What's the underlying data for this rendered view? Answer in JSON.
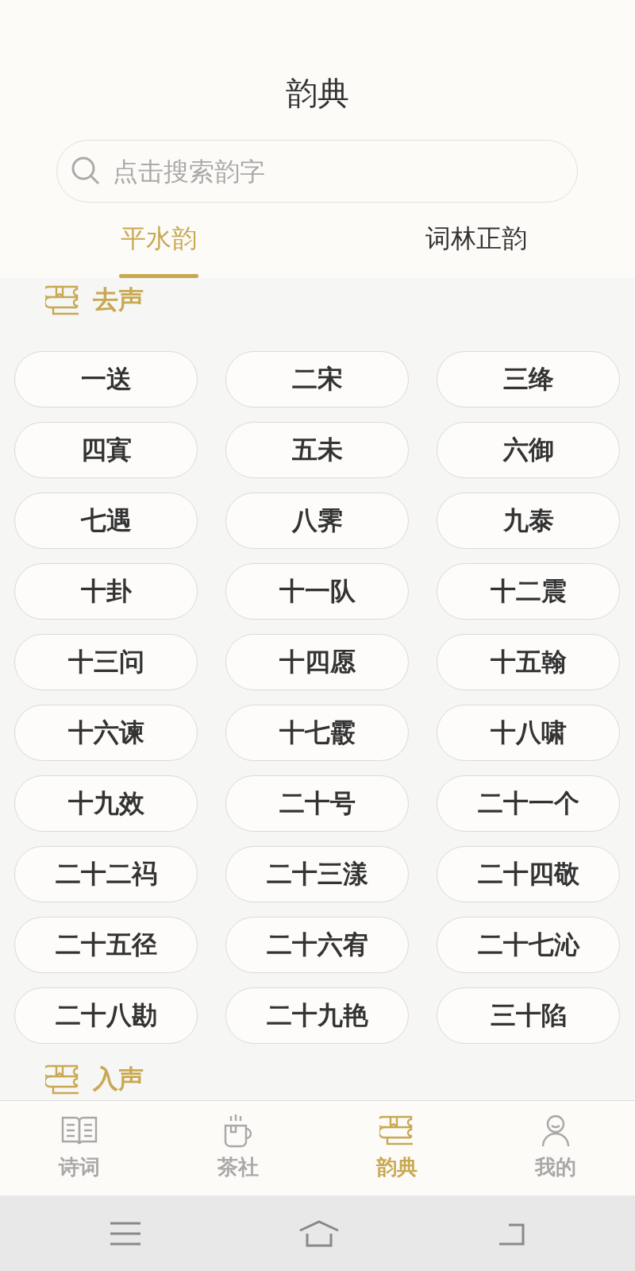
{
  "header": {
    "title": "韵典"
  },
  "search": {
    "placeholder": "点击搜索韵字"
  },
  "tabs": [
    {
      "label": "平水韵",
      "selected": true
    },
    {
      "label": "词林正韵",
      "selected": false
    }
  ],
  "sections": [
    {
      "title": "去声",
      "items": [
        "一送",
        "二宋",
        "三绛",
        "四寘",
        "五未",
        "六御",
        "七遇",
        "八霁",
        "九泰",
        "十卦",
        "十一队",
        "十二震",
        "十三问",
        "十四愿",
        "十五翰",
        "十六谏",
        "十七霰",
        "十八啸",
        "十九效",
        "二十号",
        "二十一个",
        "二十二祃",
        "二十三漾",
        "二十四敬",
        "二十五径",
        "二十六宥",
        "二十七沁",
        "二十八勘",
        "二十九艳",
        "三十陷"
      ]
    },
    {
      "title": "入声"
    }
  ],
  "bottom_nav": [
    {
      "kind": "poems",
      "label": "诗词",
      "selected": false
    },
    {
      "kind": "tea",
      "label": "茶社",
      "selected": false
    },
    {
      "kind": "dictionary",
      "label": "韵典",
      "selected": true
    },
    {
      "kind": "profile",
      "label": "我的",
      "selected": false
    }
  ]
}
